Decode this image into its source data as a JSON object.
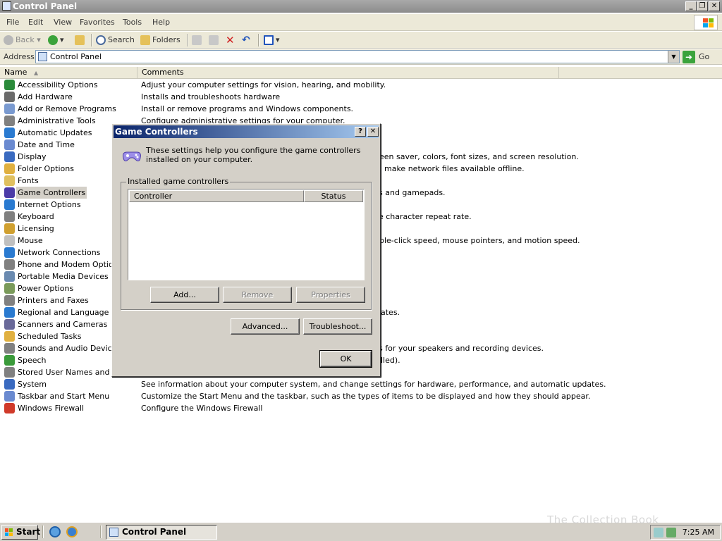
{
  "window": {
    "title": "Control Panel"
  },
  "menu": [
    "File",
    "Edit",
    "View",
    "Favorites",
    "Tools",
    "Help"
  ],
  "toolbar": {
    "back": "Back",
    "search": "Search",
    "folders": "Folders"
  },
  "address": {
    "label": "Address",
    "value": "Control Panel",
    "go": "Go"
  },
  "columns": {
    "name": "Name",
    "comments": "Comments"
  },
  "items": [
    {
      "name": "Accessibility Options",
      "comment": "Adjust your computer settings for vision, hearing, and mobility."
    },
    {
      "name": "Add Hardware",
      "comment": "Installs and troubleshoots hardware"
    },
    {
      "name": "Add or Remove Programs",
      "comment": "Install or remove programs and Windows components."
    },
    {
      "name": "Administrative Tools",
      "comment": "Configure administrative settings for your computer."
    },
    {
      "name": "Automatic Updates",
      "comment": ""
    },
    {
      "name": "Date and Time",
      "comment": ""
    },
    {
      "name": "Display",
      "comment": "een saver, colors, font sizes, and screen resolution."
    },
    {
      "name": "Folder Options",
      "comment": "make network files available offline."
    },
    {
      "name": "Fonts",
      "comment": ""
    },
    {
      "name": "Game Controllers",
      "comment": "s and gamepads."
    },
    {
      "name": "Internet Options",
      "comment": ""
    },
    {
      "name": "Keyboard",
      "comment": "e character repeat rate."
    },
    {
      "name": "Licensing",
      "comment": ""
    },
    {
      "name": "Mouse",
      "comment": "ble-click speed, mouse pointers, and motion speed."
    },
    {
      "name": "Network Connections",
      "comment": ""
    },
    {
      "name": "Phone and Modem Options",
      "comment": ""
    },
    {
      "name": "Portable Media Devices",
      "comment": ""
    },
    {
      "name": "Power Options",
      "comment": ""
    },
    {
      "name": "Printers and Faxes",
      "comment": ""
    },
    {
      "name": "Regional and Language Opt",
      "comment": "ates."
    },
    {
      "name": "Scanners and Cameras",
      "comment": ""
    },
    {
      "name": "Scheduled Tasks",
      "comment": ""
    },
    {
      "name": "Sounds and Audio Devices",
      "comment": "s for your speakers and recording devices."
    },
    {
      "name": "Speech",
      "comment": "lled)."
    },
    {
      "name": "Stored User Names and Pas",
      "comment": ""
    },
    {
      "name": "System",
      "comment": "See information about your computer system, and change settings for hardware, performance, and automatic updates."
    },
    {
      "name": "Taskbar and Start Menu",
      "comment": "Customize the Start Menu and the taskbar, such as the types of items to be displayed and how they should appear."
    },
    {
      "name": "Windows Firewall",
      "comment": "Configure the Windows Firewall"
    }
  ],
  "selected_item": "Game Controllers",
  "dialog": {
    "title": "Game Controllers",
    "help": "?",
    "intro": "These settings help you configure the game controllers installed on your computer.",
    "group_label": "Installed game controllers",
    "col_controller": "Controller",
    "col_status": "Status",
    "add": "Add...",
    "remove": "Remove",
    "properties": "Properties",
    "advanced": "Advanced...",
    "troubleshoot": "Troubleshoot...",
    "ok": "OK"
  },
  "taskbar": {
    "start": "Start",
    "task": "Control Panel",
    "clock": "7:25 AM"
  },
  "watermark": "The Collection Book",
  "icons": {
    "back": "back-arrow-icon",
    "forward": "forward-arrow-icon",
    "up": "folder-up-icon",
    "search": "search-icon",
    "folders": "folders-icon",
    "delete": "delete-icon",
    "undo": "undo-icon",
    "views": "views-icon"
  }
}
